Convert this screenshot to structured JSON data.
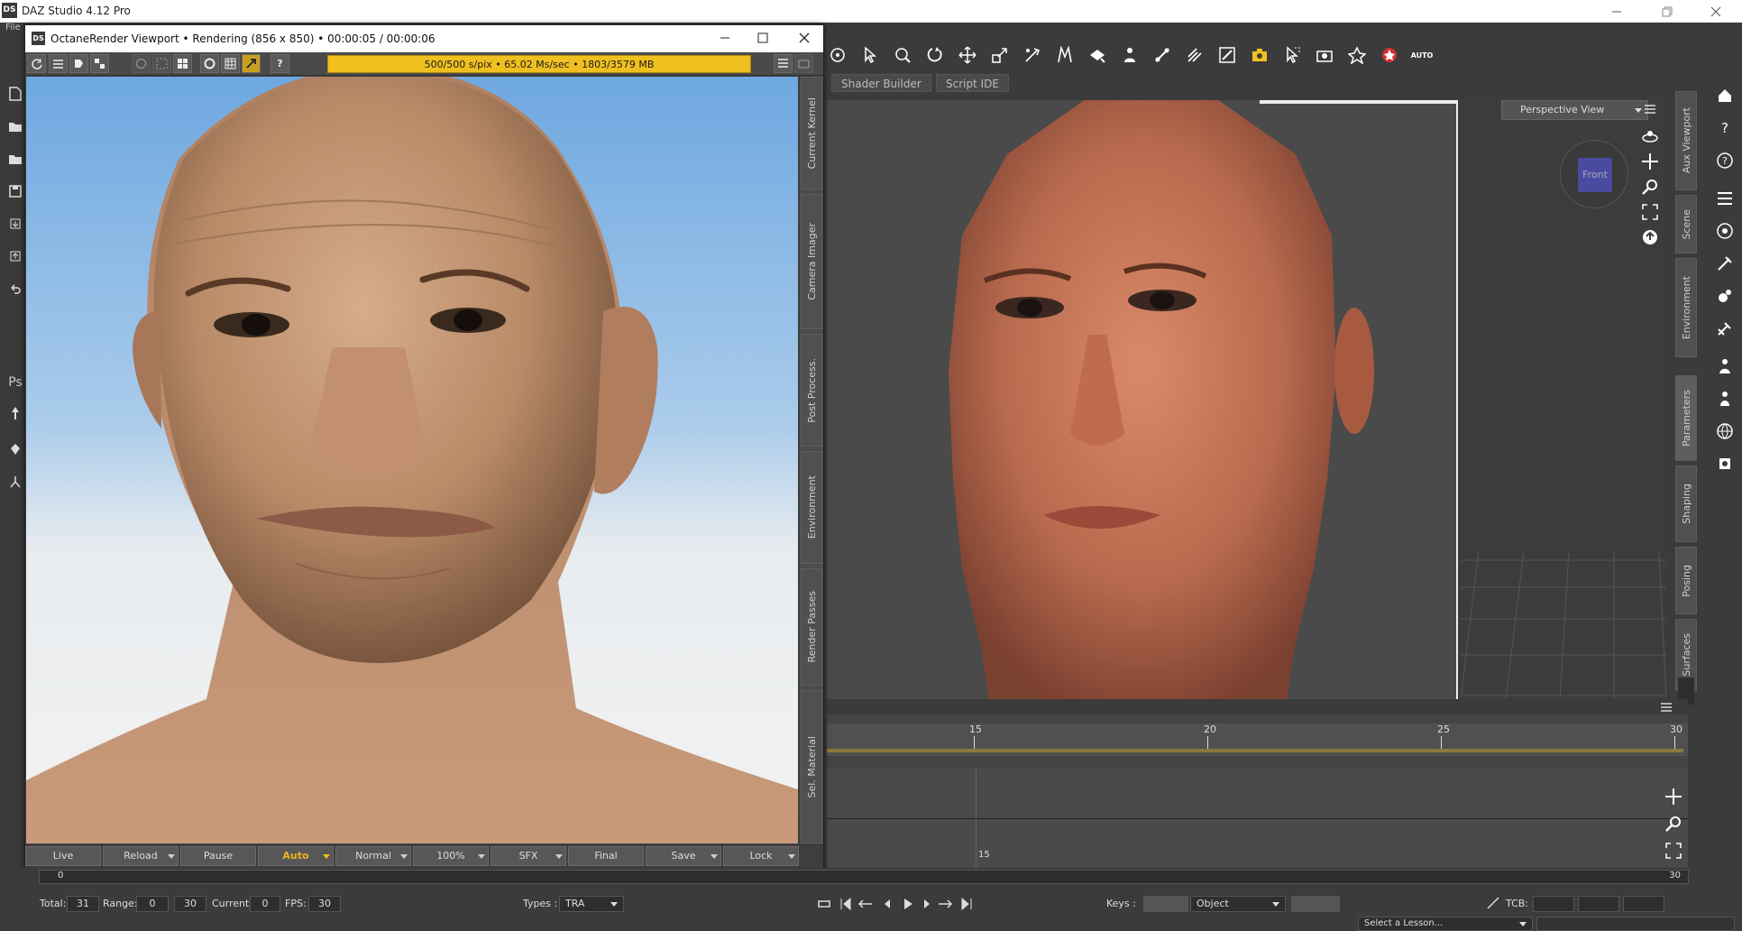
{
  "app": {
    "title": "DAZ Studio 4.12 Pro",
    "logo": "DS",
    "menu_first": "File"
  },
  "octane": {
    "logo": "DS",
    "title": "OctaneRender Viewport • Rendering (856 x 850) • 00:00:05 / 00:00:06",
    "progress": "500/500 s/pix • 65.02 Ms/sec • 1803/3579 MB",
    "side_tabs": [
      "Current Kernel",
      "Camera Imager",
      "Post Process.",
      "Environment",
      "Render Passes",
      "Sel. Material"
    ],
    "buttons": [
      {
        "label": "Live",
        "dropdown": false,
        "active": false
      },
      {
        "label": "Reload",
        "dropdown": true,
        "active": false
      },
      {
        "label": "Pause",
        "dropdown": false,
        "active": false
      },
      {
        "label": "Auto",
        "dropdown": true,
        "active": true
      },
      {
        "label": "Normal",
        "dropdown": true,
        "active": false
      },
      {
        "label": "100%",
        "dropdown": true,
        "active": false
      },
      {
        "label": "SFX",
        "dropdown": true,
        "active": false
      },
      {
        "label": "Final",
        "dropdown": false,
        "active": false
      },
      {
        "label": "Save",
        "dropdown": true,
        "active": false
      },
      {
        "label": "Lock",
        "dropdown": true,
        "active": false
      }
    ]
  },
  "viewport": {
    "tabs": [
      "Shader Builder",
      "Script IDE"
    ],
    "view_selector": "Perspective View",
    "cube_label": "Front",
    "auto_label": "AUTO"
  },
  "right_tabs": [
    "Aux Viewport",
    "Scene",
    "Environment",
    "Parameters",
    "Shaping",
    "Posing",
    "Surfaces"
  ],
  "timeline": {
    "ruler": [
      "15",
      "20",
      "25",
      "30"
    ],
    "frame_label": "15",
    "start": "0",
    "end": "30"
  },
  "status": {
    "total_label": "Total:",
    "total": "31",
    "range_label": "Range:",
    "range_start": "0",
    "range_end": "30",
    "current_label": "Current:",
    "current": "0",
    "fps_label": "FPS:",
    "fps": "30",
    "types_label": "Types :",
    "types": "TRA",
    "keys_label": "Keys :",
    "keys_target": "Object",
    "tcb_label": "TCB:",
    "lesson": "Select a Lesson..."
  },
  "colors": {
    "accent": "#f0c020",
    "active_text": "#f0b020",
    "bg": "#3b3b3b"
  }
}
